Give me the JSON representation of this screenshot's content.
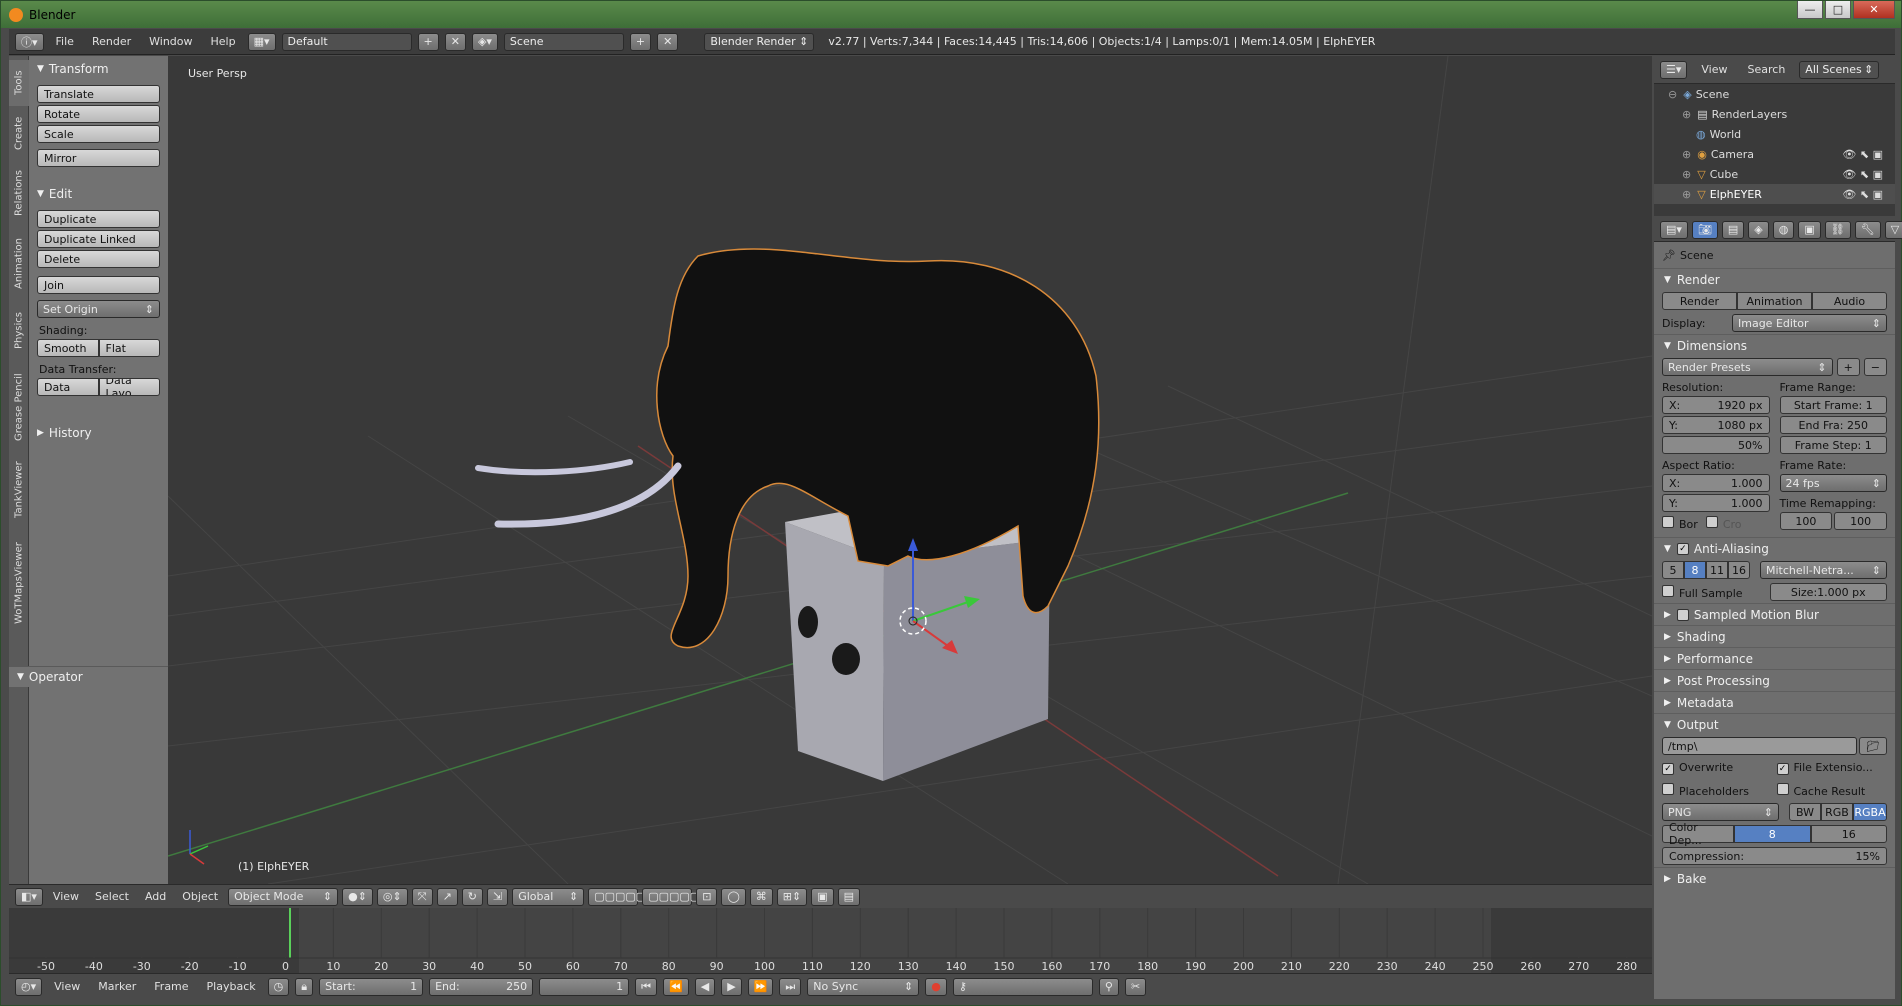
{
  "window": {
    "title": "Blender"
  },
  "infobar": {
    "menus": [
      "File",
      "Render",
      "Window",
      "Help"
    ],
    "layout": "Default",
    "scene": "Scene",
    "engine": "Blender Render",
    "stats": "v2.77 | Verts:7,344 | Faces:14,445 | Tris:14,606 | Objects:1/4 | Lamps:0/1 | Mem:14.05M | ElphEYER"
  },
  "tabs": [
    "Tools",
    "Create",
    "Relations",
    "Animation",
    "Physics",
    "Grease Pencil",
    "TankViewer",
    "WoTMapsViewer"
  ],
  "tools": {
    "transform": {
      "title": "Transform",
      "buttons": [
        "Translate",
        "Rotate",
        "Scale",
        "Mirror"
      ]
    },
    "edit": {
      "title": "Edit",
      "buttons": [
        "Duplicate",
        "Duplicate Linked",
        "Delete",
        "Join"
      ],
      "set_origin": "Set Origin",
      "shading_label": "Shading:",
      "smooth": "Smooth",
      "flat": "Flat",
      "data_transfer_label": "Data Transfer:",
      "data": "Data",
      "data_layout": "Data Layo"
    },
    "history": "History",
    "operator": "Operator"
  },
  "viewport": {
    "label": "User Persp",
    "object_label": "(1) ElphEYER"
  },
  "header3d": {
    "menus": [
      "View",
      "Select",
      "Add",
      "Object"
    ],
    "mode": "Object Mode",
    "orientation": "Global"
  },
  "timeline": {
    "ticks": [
      "-50",
      "-40",
      "-30",
      "-20",
      "-10",
      "0",
      "10",
      "20",
      "30",
      "40",
      "50",
      "60",
      "70",
      "80",
      "90",
      "100",
      "110",
      "120",
      "130",
      "140",
      "150",
      "160",
      "170",
      "180",
      "190",
      "200",
      "210",
      "220",
      "230",
      "240",
      "250",
      "260",
      "270",
      "280"
    ]
  },
  "tlheader": {
    "menus": [
      "View",
      "Marker",
      "Frame",
      "Playback"
    ],
    "start_label": "Start:",
    "start": "1",
    "end_label": "End:",
    "end": "250",
    "current": "1",
    "sync": "No Sync"
  },
  "outliner": {
    "view": "View",
    "search": "Search",
    "scenes": "All Scenes",
    "items": [
      "Scene",
      "RenderLayers",
      "World",
      "Camera",
      "Cube",
      "ElphEYER"
    ]
  },
  "properties": {
    "scene": "Scene",
    "render_title": "Render",
    "render_btns": [
      "Render",
      "Animation",
      "Audio"
    ],
    "display_label": "Display:",
    "display": "Image Editor",
    "dimensions": "Dimensions",
    "presets": "Render Presets",
    "resolution_label": "Resolution:",
    "res_x": "1920 px",
    "res_y": "1080 px",
    "res_pct": "50%",
    "frame_range_label": "Frame Range:",
    "start_frame": "Start Frame: 1",
    "end_frame": "End Fra:  250",
    "frame_step": "Frame Step: 1",
    "aspect_label": "Aspect Ratio:",
    "asp_x": "1.000",
    "asp_y": "1.000",
    "frame_rate_label": "Frame Rate:",
    "fps": "24 fps",
    "time_remap_label": "Time Remapping:",
    "remap_old": "100",
    "remap_new": "100",
    "bor": "Bor",
    "cro": "Cro",
    "aa": "Anti-Aliasing",
    "aa_samples": [
      "5",
      "8",
      "11",
      "16"
    ],
    "aa_filter": "Mitchell-Netra...",
    "full_sample": "Full Sample",
    "size": "Size:1.000 px",
    "collapsed": [
      "Sampled Motion Blur",
      "Shading",
      "Performance",
      "Post Processing",
      "Metadata"
    ],
    "output": "Output",
    "path": "/tmp\\",
    "overwrite": "Overwrite",
    "file_ext": "File Extensio...",
    "placeholders": "Placeholders",
    "cache": "Cache Result",
    "format": "PNG",
    "bw": "BW",
    "rgb": "RGB",
    "rgba": "RGBA",
    "color_depth_label": "Color Dep...",
    "depth8": "8",
    "depth16": "16",
    "compression": "Compression:",
    "compression_val": "15%",
    "bake": "Bake"
  }
}
